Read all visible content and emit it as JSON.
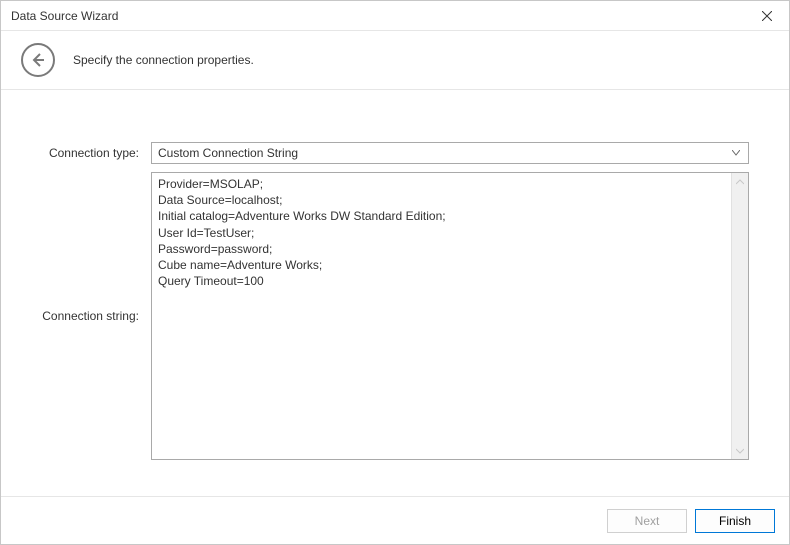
{
  "window": {
    "title": "Data Source Wizard",
    "subtitle": "Specify the connection properties."
  },
  "form": {
    "connection_type_label": "Connection type:",
    "connection_type_value": "Custom Connection String",
    "connection_string_label": "Connection string:",
    "connection_string_value": "Provider=MSOLAP;\nData Source=localhost;\nInitial catalog=Adventure Works DW Standard Edition;\nUser Id=TestUser;\nPassword=password;\nCube name=Adventure Works;\nQuery Timeout=100"
  },
  "footer": {
    "next_label": "Next",
    "finish_label": "Finish"
  }
}
